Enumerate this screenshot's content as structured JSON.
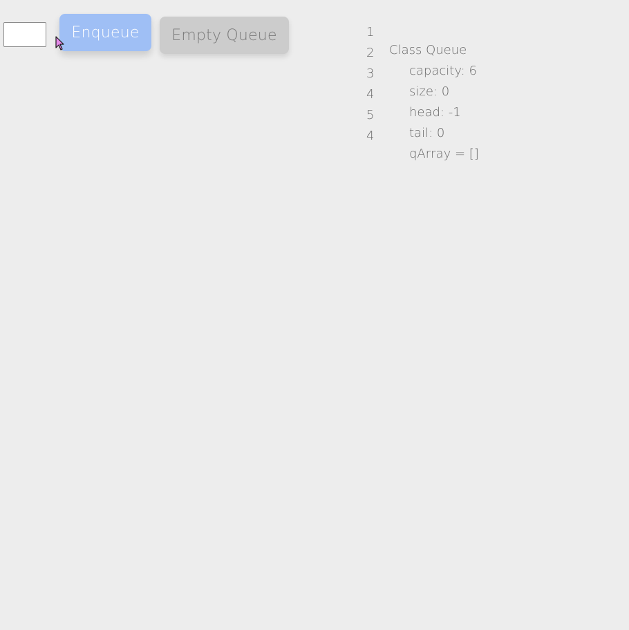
{
  "controls": {
    "input_value": "",
    "enqueue_label": "Enqueue",
    "empty_label": "Empty Queue"
  },
  "colors": {
    "background": "#ededed",
    "enqueue_bg": "#9fbff5",
    "empty_bg": "#cccccc",
    "code_text": "#6b6b6b"
  },
  "code": {
    "lines": [
      {
        "num": "1",
        "text": "Class Queue"
      },
      {
        "num": "2",
        "text": "capacity: 6"
      },
      {
        "num": "3",
        "text": "size: 0"
      },
      {
        "num": "4",
        "text": "head: -1"
      },
      {
        "num": "5",
        "text": "tail: 0"
      },
      {
        "num": "4",
        "text": "qArray = []"
      }
    ]
  },
  "cursor": {
    "icon": "pointer-cursor-icon"
  }
}
